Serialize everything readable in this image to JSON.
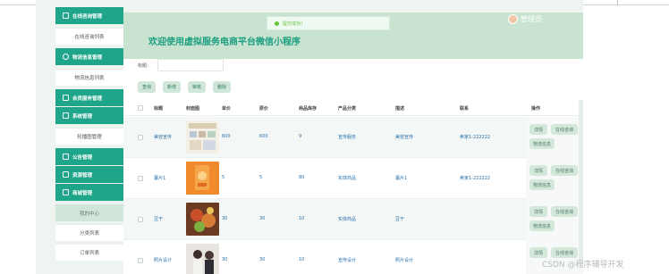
{
  "sidebar": {
    "items": [
      {
        "label": "在线咨询管理",
        "style": "green",
        "icon": "chat-icon"
      },
      {
        "label": "在线咨询列表",
        "style": "white"
      },
      {
        "label": "物流信息管理",
        "style": "green",
        "icon": "truck-icon"
      },
      {
        "label": "物流信息列表",
        "style": "white"
      },
      {
        "label": "会员服务管理",
        "style": "green",
        "icon": "member-icon"
      },
      {
        "label": "系统管理",
        "style": "green",
        "icon": "settings-icon"
      },
      {
        "label": "轮播图管理",
        "style": "white"
      },
      {
        "label": "公告管理",
        "style": "green",
        "icon": "notice-icon"
      },
      {
        "label": "资源管理",
        "style": "green",
        "icon": "resource-icon"
      },
      {
        "label": "商城管理",
        "style": "green",
        "icon": "shop-icon"
      },
      {
        "label": "我的中心",
        "style": "active"
      },
      {
        "label": "分类列表",
        "style": "white"
      },
      {
        "label": "订单列表",
        "style": "white"
      }
    ]
  },
  "header": {
    "welcome": "欢迎使用虚拟服务电商平台微信小程序",
    "toast": "提交成功！",
    "user": "管理员"
  },
  "search": {
    "label": "标题：",
    "value": ""
  },
  "toolbar": {
    "buttons": [
      "查询",
      "新增",
      "审核",
      "删除"
    ]
  },
  "table": {
    "headers": [
      "标题",
      "封面图",
      "单价",
      "原价",
      "商品库存",
      "产品分类",
      "描述",
      "联系",
      "操作"
    ],
    "rows": [
      {
        "title": "美容宣传",
        "thumb": "poster",
        "price": "600",
        "orig": "600",
        "stock": "9",
        "category": "宣传服务",
        "desc": "美容宣传",
        "contact": "卖家1-222222",
        "extra": "",
        "ops": [
          "详情",
          "在线咨询",
          "物流信息"
        ]
      },
      {
        "title": "薯片1",
        "thumb": "chips",
        "price": "5",
        "orig": "5",
        "stock": "80",
        "category": "实体商品",
        "desc": "薯片1",
        "contact": "卖家1-222222",
        "extra": "",
        "ops": [
          "详情",
          "在线咨询",
          "物流信息"
        ]
      },
      {
        "title": "豆干",
        "thumb": "food",
        "price": "30",
        "orig": "30",
        "stock": "10",
        "category": "实体商品",
        "desc": "豆干",
        "contact": "",
        "extra": "",
        "ops": [
          "详情",
          "在线咨询",
          "物流信息"
        ]
      },
      {
        "title": "照片设计",
        "thumb": "people",
        "price": "30",
        "orig": "30",
        "stock": "10",
        "category": "宣传设计",
        "desc": "照片设计",
        "contact": "",
        "extra": "",
        "ops": [
          "详情",
          "在线咨询"
        ]
      }
    ]
  },
  "watermark": "CSDN @程序辅导开发",
  "colors": {
    "accent": "#1fa58a",
    "banner": "#c8e4d1",
    "button": "#cfe6d8"
  }
}
